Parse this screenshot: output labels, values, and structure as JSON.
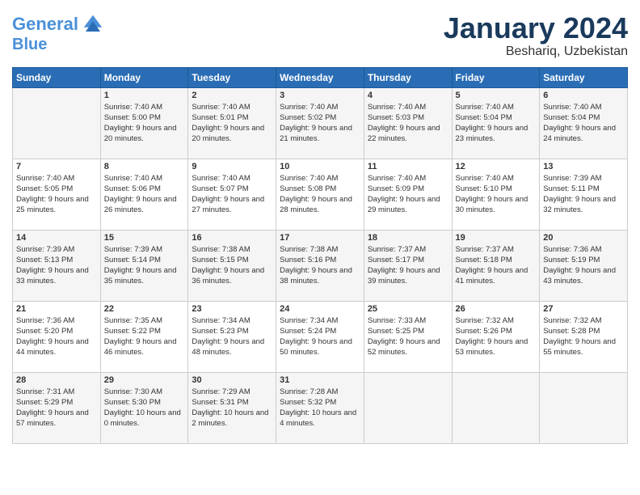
{
  "header": {
    "logo_line1": "General",
    "logo_line2": "Blue",
    "month": "January 2024",
    "location": "Beshariq, Uzbekistan"
  },
  "weekdays": [
    "Sunday",
    "Monday",
    "Tuesday",
    "Wednesday",
    "Thursday",
    "Friday",
    "Saturday"
  ],
  "weeks": [
    [
      {
        "day": "",
        "sunrise": "",
        "sunset": "",
        "daylight": ""
      },
      {
        "day": "1",
        "sunrise": "Sunrise: 7:40 AM",
        "sunset": "Sunset: 5:00 PM",
        "daylight": "Daylight: 9 hours and 20 minutes."
      },
      {
        "day": "2",
        "sunrise": "Sunrise: 7:40 AM",
        "sunset": "Sunset: 5:01 PM",
        "daylight": "Daylight: 9 hours and 20 minutes."
      },
      {
        "day": "3",
        "sunrise": "Sunrise: 7:40 AM",
        "sunset": "Sunset: 5:02 PM",
        "daylight": "Daylight: 9 hours and 21 minutes."
      },
      {
        "day": "4",
        "sunrise": "Sunrise: 7:40 AM",
        "sunset": "Sunset: 5:03 PM",
        "daylight": "Daylight: 9 hours and 22 minutes."
      },
      {
        "day": "5",
        "sunrise": "Sunrise: 7:40 AM",
        "sunset": "Sunset: 5:04 PM",
        "daylight": "Daylight: 9 hours and 23 minutes."
      },
      {
        "day": "6",
        "sunrise": "Sunrise: 7:40 AM",
        "sunset": "Sunset: 5:04 PM",
        "daylight": "Daylight: 9 hours and 24 minutes."
      }
    ],
    [
      {
        "day": "7",
        "sunrise": "Sunrise: 7:40 AM",
        "sunset": "Sunset: 5:05 PM",
        "daylight": "Daylight: 9 hours and 25 minutes."
      },
      {
        "day": "8",
        "sunrise": "Sunrise: 7:40 AM",
        "sunset": "Sunset: 5:06 PM",
        "daylight": "Daylight: 9 hours and 26 minutes."
      },
      {
        "day": "9",
        "sunrise": "Sunrise: 7:40 AM",
        "sunset": "Sunset: 5:07 PM",
        "daylight": "Daylight: 9 hours and 27 minutes."
      },
      {
        "day": "10",
        "sunrise": "Sunrise: 7:40 AM",
        "sunset": "Sunset: 5:08 PM",
        "daylight": "Daylight: 9 hours and 28 minutes."
      },
      {
        "day": "11",
        "sunrise": "Sunrise: 7:40 AM",
        "sunset": "Sunset: 5:09 PM",
        "daylight": "Daylight: 9 hours and 29 minutes."
      },
      {
        "day": "12",
        "sunrise": "Sunrise: 7:40 AM",
        "sunset": "Sunset: 5:10 PM",
        "daylight": "Daylight: 9 hours and 30 minutes."
      },
      {
        "day": "13",
        "sunrise": "Sunrise: 7:39 AM",
        "sunset": "Sunset: 5:11 PM",
        "daylight": "Daylight: 9 hours and 32 minutes."
      }
    ],
    [
      {
        "day": "14",
        "sunrise": "Sunrise: 7:39 AM",
        "sunset": "Sunset: 5:13 PM",
        "daylight": "Daylight: 9 hours and 33 minutes."
      },
      {
        "day": "15",
        "sunrise": "Sunrise: 7:39 AM",
        "sunset": "Sunset: 5:14 PM",
        "daylight": "Daylight: 9 hours and 35 minutes."
      },
      {
        "day": "16",
        "sunrise": "Sunrise: 7:38 AM",
        "sunset": "Sunset: 5:15 PM",
        "daylight": "Daylight: 9 hours and 36 minutes."
      },
      {
        "day": "17",
        "sunrise": "Sunrise: 7:38 AM",
        "sunset": "Sunset: 5:16 PM",
        "daylight": "Daylight: 9 hours and 38 minutes."
      },
      {
        "day": "18",
        "sunrise": "Sunrise: 7:37 AM",
        "sunset": "Sunset: 5:17 PM",
        "daylight": "Daylight: 9 hours and 39 minutes."
      },
      {
        "day": "19",
        "sunrise": "Sunrise: 7:37 AM",
        "sunset": "Sunset: 5:18 PM",
        "daylight": "Daylight: 9 hours and 41 minutes."
      },
      {
        "day": "20",
        "sunrise": "Sunrise: 7:36 AM",
        "sunset": "Sunset: 5:19 PM",
        "daylight": "Daylight: 9 hours and 43 minutes."
      }
    ],
    [
      {
        "day": "21",
        "sunrise": "Sunrise: 7:36 AM",
        "sunset": "Sunset: 5:20 PM",
        "daylight": "Daylight: 9 hours and 44 minutes."
      },
      {
        "day": "22",
        "sunrise": "Sunrise: 7:35 AM",
        "sunset": "Sunset: 5:22 PM",
        "daylight": "Daylight: 9 hours and 46 minutes."
      },
      {
        "day": "23",
        "sunrise": "Sunrise: 7:34 AM",
        "sunset": "Sunset: 5:23 PM",
        "daylight": "Daylight: 9 hours and 48 minutes."
      },
      {
        "day": "24",
        "sunrise": "Sunrise: 7:34 AM",
        "sunset": "Sunset: 5:24 PM",
        "daylight": "Daylight: 9 hours and 50 minutes."
      },
      {
        "day": "25",
        "sunrise": "Sunrise: 7:33 AM",
        "sunset": "Sunset: 5:25 PM",
        "daylight": "Daylight: 9 hours and 52 minutes."
      },
      {
        "day": "26",
        "sunrise": "Sunrise: 7:32 AM",
        "sunset": "Sunset: 5:26 PM",
        "daylight": "Daylight: 9 hours and 53 minutes."
      },
      {
        "day": "27",
        "sunrise": "Sunrise: 7:32 AM",
        "sunset": "Sunset: 5:28 PM",
        "daylight": "Daylight: 9 hours and 55 minutes."
      }
    ],
    [
      {
        "day": "28",
        "sunrise": "Sunrise: 7:31 AM",
        "sunset": "Sunset: 5:29 PM",
        "daylight": "Daylight: 9 hours and 57 minutes."
      },
      {
        "day": "29",
        "sunrise": "Sunrise: 7:30 AM",
        "sunset": "Sunset: 5:30 PM",
        "daylight": "Daylight: 10 hours and 0 minutes."
      },
      {
        "day": "30",
        "sunrise": "Sunrise: 7:29 AM",
        "sunset": "Sunset: 5:31 PM",
        "daylight": "Daylight: 10 hours and 2 minutes."
      },
      {
        "day": "31",
        "sunrise": "Sunrise: 7:28 AM",
        "sunset": "Sunset: 5:32 PM",
        "daylight": "Daylight: 10 hours and 4 minutes."
      },
      {
        "day": "",
        "sunrise": "",
        "sunset": "",
        "daylight": ""
      },
      {
        "day": "",
        "sunrise": "",
        "sunset": "",
        "daylight": ""
      },
      {
        "day": "",
        "sunrise": "",
        "sunset": "",
        "daylight": ""
      }
    ]
  ]
}
